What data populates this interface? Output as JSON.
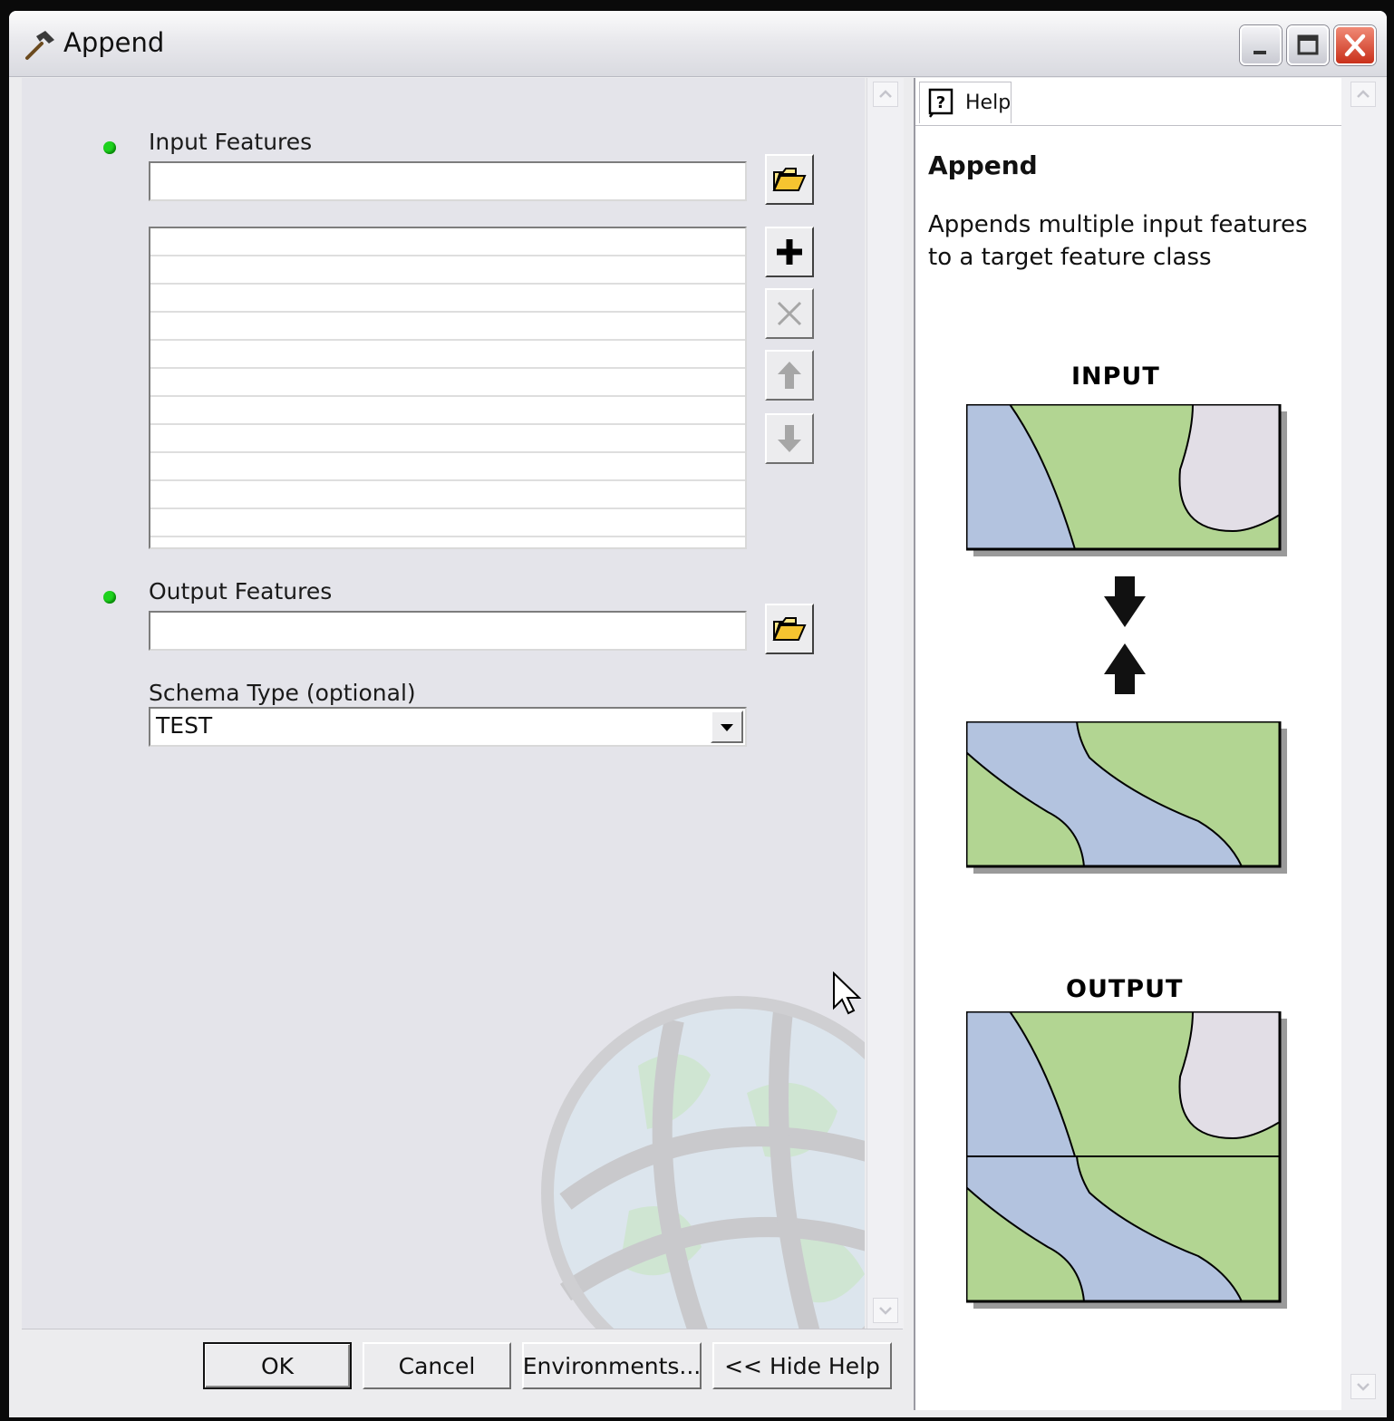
{
  "window": {
    "title": "Append"
  },
  "form": {
    "input_features": {
      "label": "Input Features",
      "value": ""
    },
    "output_features": {
      "label": "Output Features",
      "value": ""
    },
    "schema_type": {
      "label": "Schema Type (optional)",
      "value": "TEST"
    }
  },
  "buttons": {
    "ok": "OK",
    "cancel": "Cancel",
    "environments": "Environments...",
    "hide_help": "<< Hide Help"
  },
  "help": {
    "tab_label": "Help",
    "title": "Append",
    "description": "Appends multiple input features to a target feature class",
    "input_caption": "INPUT",
    "output_caption": "OUTPUT"
  },
  "colors": {
    "map_blue": "#b3c3df",
    "map_green": "#b2d592",
    "map_lilac": "#e2dee6",
    "required_dot": "#1ed21e"
  },
  "icons": [
    "hammer-icon",
    "minimize-icon",
    "maximize-icon",
    "close-icon",
    "folder-open-icon",
    "add-icon",
    "delete-icon",
    "move-up-icon",
    "move-down-icon",
    "chevron-down-icon",
    "help-icon",
    "arrow-down-icon",
    "arrow-up-icon",
    "cursor-icon"
  ]
}
